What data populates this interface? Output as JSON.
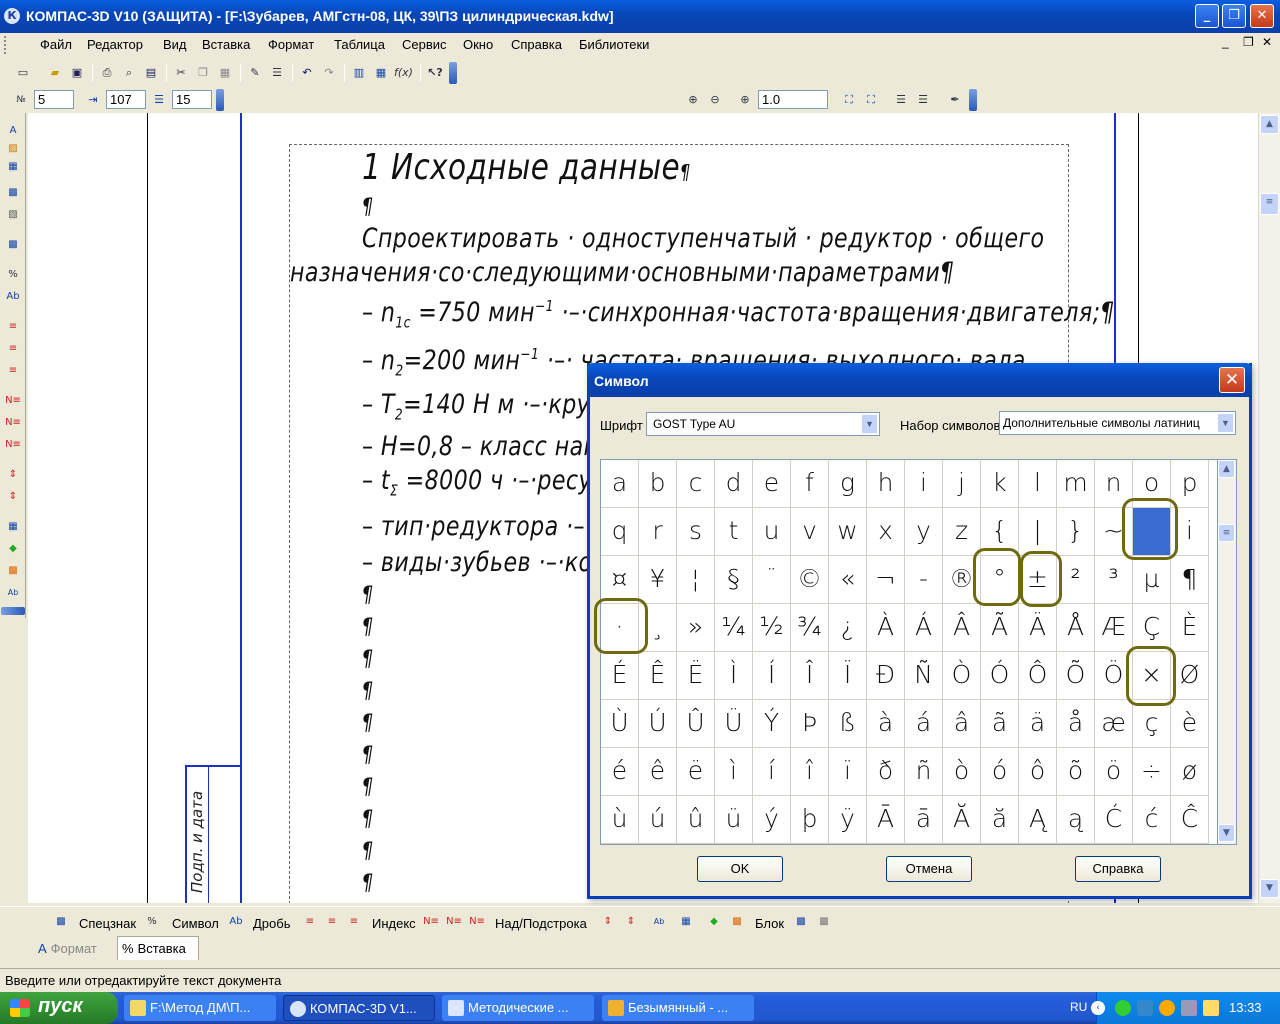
{
  "window": {
    "title": "КОМПАС-3D V10 (ЗАЩИТА) - [F:\\Зубарев, АМГстн-08, ЦК, 39\\ПЗ цилиндрическая.kdw]",
    "app_icon": "К"
  },
  "menu": [
    "Файл",
    "Редактор",
    "Вид",
    "Вставка",
    "Формат",
    "Таблица",
    "Сервис",
    "Окно",
    "Справка",
    "Библиотеки"
  ],
  "toolbar_fields": {
    "number": "5",
    "indent": "107",
    "spacing": "15",
    "zoom": "1.0"
  },
  "document": {
    "heading": "1 Исходные данные",
    "para_line1": "Спроектировать · одноступенчатый · редуктор · общего",
    "para_line2": "назначения·со·следующими·основными·параметрами",
    "item1_a": "– n",
    "item1_sub": "1c",
    "item1_b": " =750 мин",
    "item1_sup": "−1",
    "item1_c": " ·–·синхронная·частота·вращения·двигателя;",
    "item2_a": "– n",
    "item2_sub": "2",
    "item2_b": "=200 мин",
    "item2_sup": "−1",
    "item2_c": " ·–· частота· вращения· выходного· вала",
    "item3_a": "– T",
    "item3_sub": "2",
    "item3_b": "=140 Н м ·–·круп",
    "item4": "– H=0,8 – класс наг",
    "item5_a": "– t",
    "item5_sub": "Σ",
    "item5_b": " =8000 ч ·–·ресу",
    "item6": "– тип·редуктора ·–",
    "item7": "– виды·зубьев ·–·ко",
    "pilcrow": "¶",
    "stamp_text": "Подп. и дата"
  },
  "dialog": {
    "title": "Символ",
    "font_label": "Шрифт",
    "font_value": "GOST Type AU",
    "set_label": "Набор символов",
    "set_value": "Дополнительные символы латиниц",
    "ok": "OK",
    "cancel": "Отмена",
    "help": "Справка",
    "rows": [
      [
        "a",
        "b",
        "c",
        "d",
        "e",
        "f",
        "g",
        "h",
        "i",
        "j",
        "k",
        "l",
        "m",
        "n",
        "o",
        "p"
      ],
      [
        "q",
        "r",
        "s",
        "t",
        "u",
        "v",
        "w",
        "x",
        "y",
        "z",
        "{",
        "|",
        "}",
        "~",
        "",
        "i"
      ],
      [
        "¤",
        "¥",
        "¦",
        "§",
        "¨",
        "©",
        "«",
        "¬",
        "-",
        "®",
        "°",
        "±",
        "²",
        "³",
        "µ",
        "¶"
      ],
      [
        "·",
        "¸",
        "»",
        "¼",
        "½",
        "¾",
        "¿",
        "À",
        "Á",
        "Â",
        "Ã",
        "Ä",
        "Å",
        "Æ",
        "Ç",
        "È"
      ],
      [
        "É",
        "Ê",
        "Ë",
        "Ì",
        "Í",
        "Î",
        "Ï",
        "Ð",
        "Ñ",
        "Ò",
        "Ó",
        "Ô",
        "Õ",
        "Ö",
        "×",
        "Ø"
      ],
      [
        "Ù",
        "Ú",
        "Û",
        "Ü",
        "Ý",
        "Þ",
        "ß",
        "à",
        "á",
        "â",
        "ã",
        "ä",
        "å",
        "æ",
        "ç",
        "è"
      ],
      [
        "é",
        "ê",
        "ë",
        "ì",
        "í",
        "î",
        "ï",
        "ð",
        "ñ",
        "ò",
        "ó",
        "ô",
        "õ",
        "ö",
        "÷",
        "ø"
      ],
      [
        "ù",
        "ú",
        "û",
        "ü",
        "ý",
        "þ",
        "ÿ",
        "Ā",
        "ā",
        "Ă",
        "ă",
        "Ą",
        "ą",
        "Ć",
        "ć",
        "Ĉ"
      ]
    ]
  },
  "bottom_panel": {
    "special": "Спецзнак",
    "symbol": "Символ",
    "fraction": "Дробь",
    "index": "Индекс",
    "over_under": "Над/Подстрока",
    "block": "Блок"
  },
  "tabs": {
    "format": "Формат",
    "insert": "Вставка"
  },
  "status": "Введите или отредактируйте текст документа",
  "taskbar": {
    "start": "пуск",
    "tasks": [
      "F:\\Метод ДМ\\П...",
      "КОМПАС-3D V1...",
      "Методические ...",
      "Безымянный - ..."
    ],
    "lang": "RU",
    "clock": "13:33"
  },
  "colors": {
    "xp_blue": "#0a5fe0",
    "selection": "#3a6bd0",
    "marker": "#6f6a10"
  }
}
